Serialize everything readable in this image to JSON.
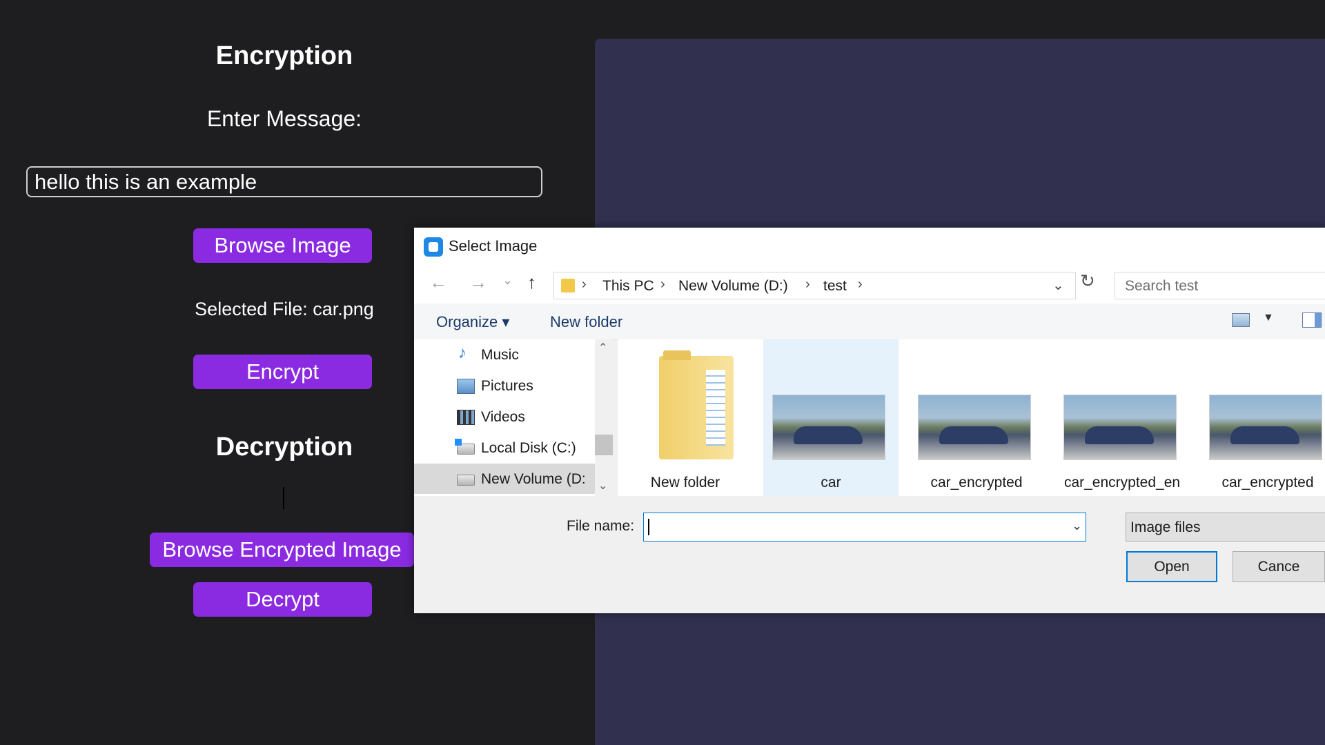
{
  "encryption": {
    "heading": "Encryption",
    "message_label": "Enter Message:",
    "message_value": "hello this is an example",
    "browse_label": "Browse Image",
    "selected_file": "Selected File: car.png",
    "encrypt_label": "Encrypt"
  },
  "decryption": {
    "heading": "Decryption",
    "browse_label": "Browse Encrypted Image",
    "decrypt_label": "Decrypt"
  },
  "colors": {
    "background": "#1e1e20",
    "canvas": "#31304f",
    "button": "#8a2be2",
    "dialog": "#f0f0f0",
    "selection": "#e5f1fb",
    "focus": "#0078d7"
  },
  "dialog": {
    "title": "Select Image",
    "breadcrumb": [
      "This PC",
      "New Volume (D:)",
      "test"
    ],
    "search_placeholder": "Search test",
    "toolbar": {
      "organize": "Organize ▾",
      "new_folder": "New folder"
    },
    "nav_items": [
      {
        "label": "Music",
        "icon": "music-icon"
      },
      {
        "label": "Pictures",
        "icon": "pictures-icon"
      },
      {
        "label": "Videos",
        "icon": "videos-icon"
      },
      {
        "label": "Local Disk (C:)",
        "icon": "drive-icon"
      },
      {
        "label": "New Volume (D:",
        "icon": "drive-icon",
        "selected": true
      }
    ],
    "files": [
      {
        "name": "New folder",
        "kind": "folder"
      },
      {
        "name": "car",
        "kind": "image",
        "selected": true
      },
      {
        "name": "car_encrypted",
        "kind": "image"
      },
      {
        "name": "car_encrypted_en",
        "kind": "image"
      },
      {
        "name": "car_encrypted",
        "kind": "image"
      }
    ],
    "file_name_label": "File name:",
    "file_name_value": "",
    "file_type": "Image files",
    "open_label": "Open",
    "cancel_label": "Cance"
  }
}
